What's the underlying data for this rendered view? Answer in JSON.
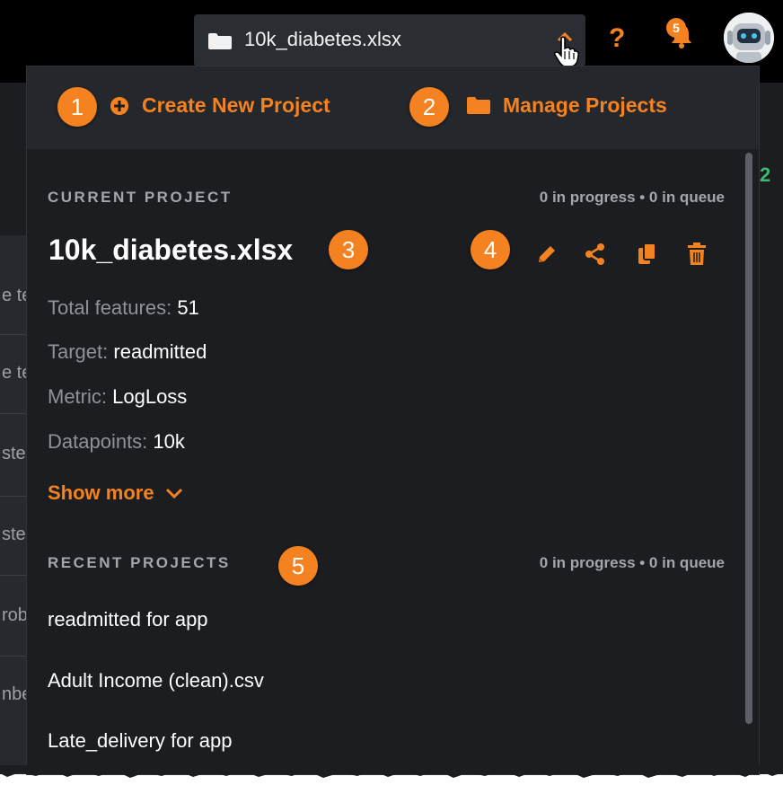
{
  "topbar": {
    "project_name": "10k_diabetes.xlsx",
    "help_symbol": "?",
    "notifications_count": "5",
    "icons": [
      "folder-icon",
      "chevron-up-icon",
      "help-icon",
      "bell-icon",
      "avatar"
    ]
  },
  "background": {
    "row_fragments": [
      "e te",
      "e te",
      "ste",
      "ste",
      "rob",
      "nbe"
    ],
    "right_fragment": "2"
  },
  "menu": {
    "create_label": "Create New Project",
    "manage_label": "Manage Projects",
    "current": {
      "section_title": "CURRENT PROJECT",
      "queue_status": "0 in progress • 0 in queue",
      "name": "10k_diabetes.xlsx",
      "properties": [
        {
          "label": "Total features:",
          "value": "51"
        },
        {
          "label": "Target:",
          "value": "readmitted"
        },
        {
          "label": "Metric:",
          "value": "LogLoss"
        },
        {
          "label": "Datapoints:",
          "value": "10k"
        }
      ],
      "show_more": "Show more",
      "tools": [
        "edit-icon",
        "share-icon",
        "copy-icon",
        "trash-icon"
      ]
    },
    "recent": {
      "section_title": "RECENT PROJECTS",
      "queue_status": "0 in progress • 0 in queue",
      "items": [
        "readmitted for app",
        "Adult Income (clean).csv",
        "Late_delivery for app"
      ]
    }
  },
  "callouts": [
    "1",
    "2",
    "3",
    "4",
    "5"
  ],
  "colors": {
    "accent": "#f58220",
    "panel": "#1b1d20",
    "header": "#24272b",
    "text": "#ffffff",
    "muted": "#8f9398"
  }
}
